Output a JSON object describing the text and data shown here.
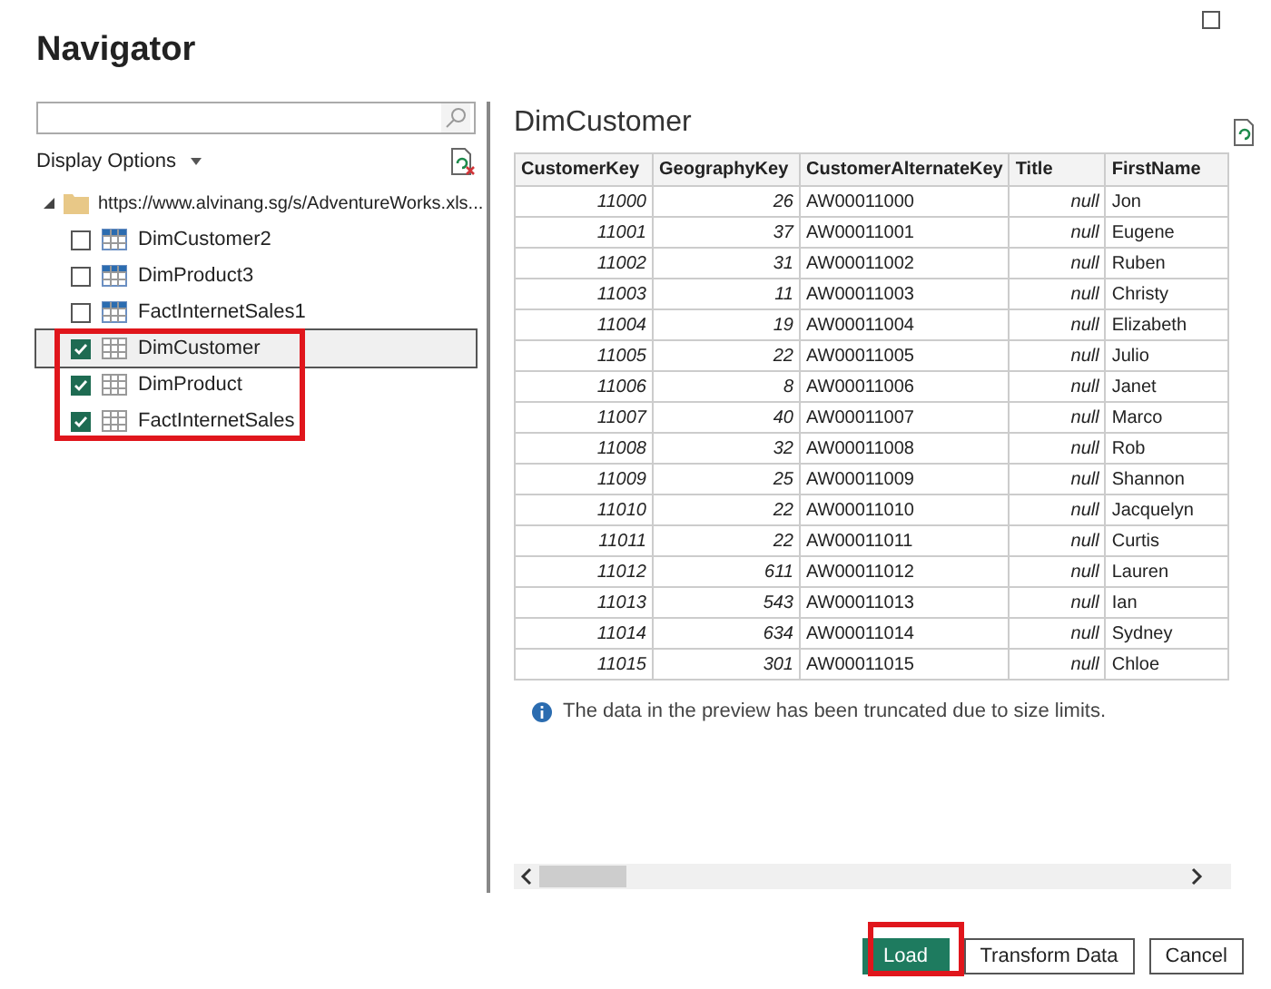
{
  "window": {
    "title": "Navigator"
  },
  "display_options": {
    "label": "Display Options"
  },
  "tree": {
    "label": "https://www.alvinang.sg/s/AdventureWorks.xls...",
    "expanded": true,
    "children": [
      {
        "label": "DimCustomer2",
        "checked": false,
        "selected": false,
        "highlighted": false,
        "kind": "table"
      },
      {
        "label": "DimProduct3",
        "checked": false,
        "selected": false,
        "highlighted": false,
        "kind": "table"
      },
      {
        "label": "FactInternetSales1",
        "checked": false,
        "selected": false,
        "highlighted": false,
        "kind": "table"
      },
      {
        "label": "DimCustomer",
        "checked": true,
        "selected": true,
        "highlighted": true,
        "kind": "sheet"
      },
      {
        "label": "DimProduct",
        "checked": true,
        "selected": false,
        "highlighted": true,
        "kind": "sheet"
      },
      {
        "label": "FactInternetSales",
        "checked": true,
        "selected": false,
        "highlighted": true,
        "kind": "sheet"
      }
    ]
  },
  "preview": {
    "title": "DimCustomer",
    "table": {
      "columns": [
        "CustomerKey",
        "GeographyKey",
        "CustomerAlternateKey",
        "Title",
        "FirstName"
      ],
      "rows": [
        [
          "11000",
          "26",
          "AW00011000",
          "null",
          "Jon"
        ],
        [
          "11001",
          "37",
          "AW00011001",
          "null",
          "Eugene"
        ],
        [
          "11002",
          "31",
          "AW00011002",
          "null",
          "Ruben"
        ],
        [
          "11003",
          "11",
          "AW00011003",
          "null",
          "Christy"
        ],
        [
          "11004",
          "19",
          "AW00011004",
          "null",
          "Elizabeth"
        ],
        [
          "11005",
          "22",
          "AW00011005",
          "null",
          "Julio"
        ],
        [
          "11006",
          "8",
          "AW00011006",
          "null",
          "Janet"
        ],
        [
          "11007",
          "40",
          "AW00011007",
          "null",
          "Marco"
        ],
        [
          "11008",
          "32",
          "AW00011008",
          "null",
          "Rob"
        ],
        [
          "11009",
          "25",
          "AW00011009",
          "null",
          "Shannon"
        ],
        [
          "11010",
          "22",
          "AW00011010",
          "null",
          "Jacquelyn"
        ],
        [
          "11011",
          "22",
          "AW00011011",
          "null",
          "Curtis"
        ],
        [
          "11012",
          "611",
          "AW00011012",
          "null",
          "Lauren"
        ],
        [
          "11013",
          "543",
          "AW00011013",
          "null",
          "Ian"
        ],
        [
          "11014",
          "634",
          "AW00011014",
          "null",
          "Sydney"
        ],
        [
          "11015",
          "301",
          "AW00011015",
          "null",
          "Chloe"
        ]
      ]
    },
    "notice": "The data in the preview has been truncated due to size limits."
  },
  "buttons": [
    {
      "label": "Load",
      "kind": "primary",
      "highlighted": true
    },
    {
      "label": "Transform Data",
      "kind": "secondary",
      "highlighted": false
    },
    {
      "label": "Cancel",
      "kind": "secondary",
      "highlighted": false
    }
  ]
}
